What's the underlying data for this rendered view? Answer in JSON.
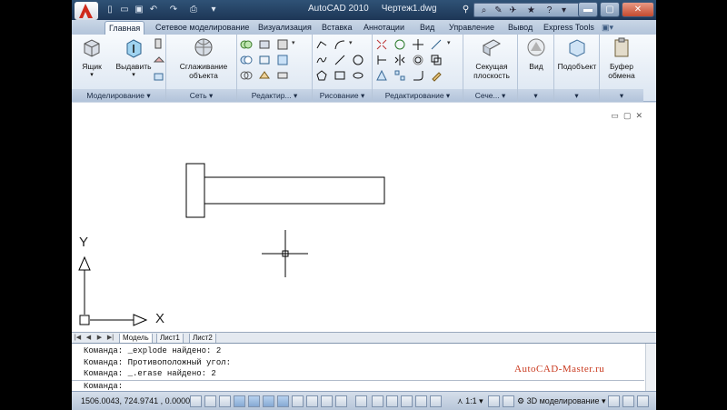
{
  "window": {
    "app_title": "AutoCAD 2010",
    "doc_title": "Чертеж1.dwg"
  },
  "tabs": [
    {
      "label": "Главная",
      "active": true
    },
    {
      "label": "Сетевое моделирование"
    },
    {
      "label": "Визуализация"
    },
    {
      "label": "Вставка"
    },
    {
      "label": "Аннотации"
    },
    {
      "label": "Вид"
    },
    {
      "label": "Управление"
    },
    {
      "label": "Вывод"
    },
    {
      "label": "Express Tools"
    }
  ],
  "ribbon": {
    "modeling": {
      "title": "Моделирование",
      "box_label": "Ящик",
      "extrude_label": "Выдавить"
    },
    "mesh": {
      "title": "Сеть",
      "smooth_label": "Сглаживание\nобъекта"
    },
    "edit_solid": {
      "title": "Редактир..."
    },
    "draw": {
      "title": "Рисование"
    },
    "modify": {
      "title": "Редактирование"
    },
    "section": {
      "title": "Сече...",
      "plane_label": "Секущая\nплоскость"
    },
    "view": {
      "label": "Вид"
    },
    "subobject": {
      "label": "Подобъект"
    },
    "clipboard": {
      "label": "Буфер\nобмена"
    }
  },
  "drawing": {
    "ucs_x": "X",
    "ucs_y": "Y"
  },
  "layout_tabs": [
    "Модель",
    "Лист1",
    "Лист2"
  ],
  "command": {
    "history": [
      "Команда: _explode найдено: 2",
      "Команда: Противоположный угол:",
      "Команда: _.erase найдено: 2"
    ],
    "prompt": "Команда:",
    "watermark": "AutoCAD-Master.ru"
  },
  "status": {
    "coords": "1506.0043, 724.9741 , 0.0000",
    "scale": "1:1",
    "workspace": "3D моделирование"
  },
  "colors": {
    "accent": "#c9391e",
    "titlebar": "#1d3656"
  }
}
